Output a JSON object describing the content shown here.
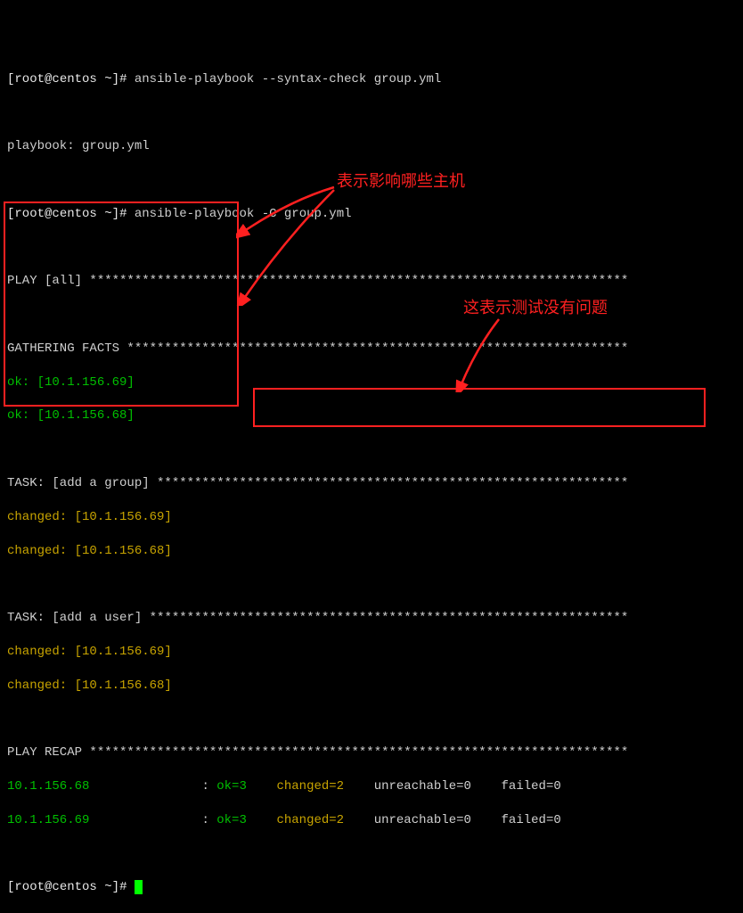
{
  "prompt_user": "root",
  "prompt_host": "centos",
  "prompt_path": "~",
  "prompt_symbol": "#",
  "cmd1": "ansible-playbook --syntax-check group.yml",
  "cmd2": "ansible-playbook -C group.yml",
  "playbook_line": "playbook: group.yml",
  "play_header": "PLAY [all] ",
  "play_stars": "************************************************************************",
  "gather_header": "GATHERING FACTS ",
  "gather_stars": "*******************************************************************",
  "gather_ok1": "ok: [10.1.156.69]",
  "gather_ok2": "ok: [10.1.156.68]",
  "task1_header": "TASK: [add a group] ",
  "task1_stars_a": "********",
  "task1_stars_b": "*******************************************************",
  "task1_ch1": "changed: [10.1.156.69]",
  "task1_ch2": "changed: [10.1.156.68]",
  "task2_header": "TASK: [add a user] ",
  "task2_stars_a": "********",
  "task2_stars_b": "********************************************************",
  "task2_ch1": "changed: [10.1.156.69]",
  "task2_ch2": "changed: [10.1.156.68]",
  "recap_header": "PLAY RECAP ",
  "recap_stars_a": "*******************",
  "recap_stars_b": "*****************************************************",
  "recap_host1": "10.1.156.68",
  "recap_host2": "10.1.156.69",
  "recap_sep": "               : ",
  "recap_ok": "ok=3",
  "recap_changed": "changed=2",
  "recap_unreach": "unreachable=0",
  "recap_failed": "failed=0",
  "sp1": "    ",
  "sp2": "    ",
  "sp3": "    ",
  "annotation1": "表示影响哪些主机",
  "annotation2": "这表示测试没有问题",
  "colors": {
    "green": "#00c000",
    "yellow": "#c8a400",
    "cyan": "#00c0c0",
    "red": "#ff2020",
    "text": "#d0d0d0",
    "bg": "#000000"
  }
}
